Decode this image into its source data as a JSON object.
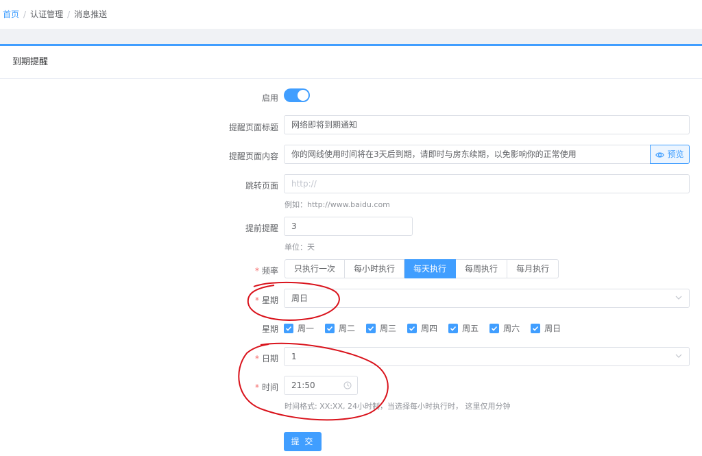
{
  "breadcrumb": {
    "home": "首页",
    "section": "认证管理",
    "current": "消息推送",
    "separator": "/"
  },
  "card": {
    "title": "到期提醒"
  },
  "form": {
    "enabled": {
      "label": "启用",
      "value": true
    },
    "page_title": {
      "label": "提醒页面标题",
      "value": "网络即将到期通知"
    },
    "page_content": {
      "label": "提醒页面内容",
      "value": "你的网线使用时间将在3天后到期，请即时与房东续期，以免影响你的正常使用",
      "preview_label": "预览"
    },
    "redirect": {
      "label": "跳转页面",
      "placeholder": "http://",
      "hint": "例如：http://www.baidu.com"
    },
    "advance": {
      "label": "提前提醒",
      "value": "3",
      "hint": "单位：天"
    },
    "frequency": {
      "label": "频率",
      "required": "*",
      "options": [
        "只执行一次",
        "每小时执行",
        "每天执行",
        "每周执行",
        "每月执行"
      ],
      "selected": "每天执行"
    },
    "weekday_select": {
      "label": "星期",
      "required": "*",
      "value": "周日"
    },
    "weekdays": {
      "label": "星期",
      "items": [
        "周一",
        "周二",
        "周三",
        "周四",
        "周五",
        "周六",
        "周日"
      ],
      "checked": [
        true,
        true,
        true,
        true,
        true,
        true,
        true
      ]
    },
    "day": {
      "label": "日期",
      "required": "*",
      "value": "1"
    },
    "time": {
      "label": "时间",
      "required": "*",
      "value": "21:50",
      "hint": "时间格式: XX:XX, 24小时制，当选择每小时执行时， 这里仅用分钟"
    },
    "submit_label": "提 交"
  },
  "colors": {
    "primary": "#409eff",
    "annotation": "#d9121b",
    "required": "#f56c6c"
  },
  "icons": {
    "preview": "eye-icon",
    "select": "chevron-down-icon",
    "time": "clock-icon",
    "check": "check-icon"
  }
}
